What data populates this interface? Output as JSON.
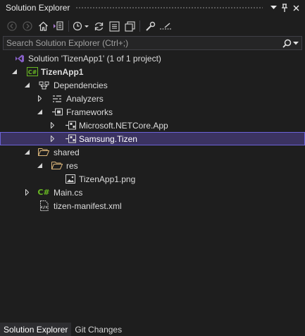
{
  "window": {
    "title": "Solution Explorer"
  },
  "search": {
    "placeholder": "Search Solution Explorer (Ctrl+;)"
  },
  "tree": {
    "solution": "Solution 'TizenApp1' (1 of 1 project)",
    "project": "TizenApp1",
    "dependencies": "Dependencies",
    "analyzers": "Analyzers",
    "frameworks": "Frameworks",
    "netcore": "Microsoft.NETCore.App",
    "tizen": "Samsung.Tizen",
    "shared": "shared",
    "res": "res",
    "png": "TizenApp1.png",
    "main": "Main.cs",
    "manifest": "tizen-manifest.xml"
  },
  "icons": {
    "project_badge": "C#",
    "cs_badge": "C#"
  },
  "tabs": [
    "Solution Explorer",
    "Git Changes"
  ],
  "colors": {
    "background": "#1e1e1e",
    "selection": "#3b3361",
    "selection_border": "#6b62d6",
    "folder": "#dcb67a",
    "csharp": "#68b723"
  }
}
